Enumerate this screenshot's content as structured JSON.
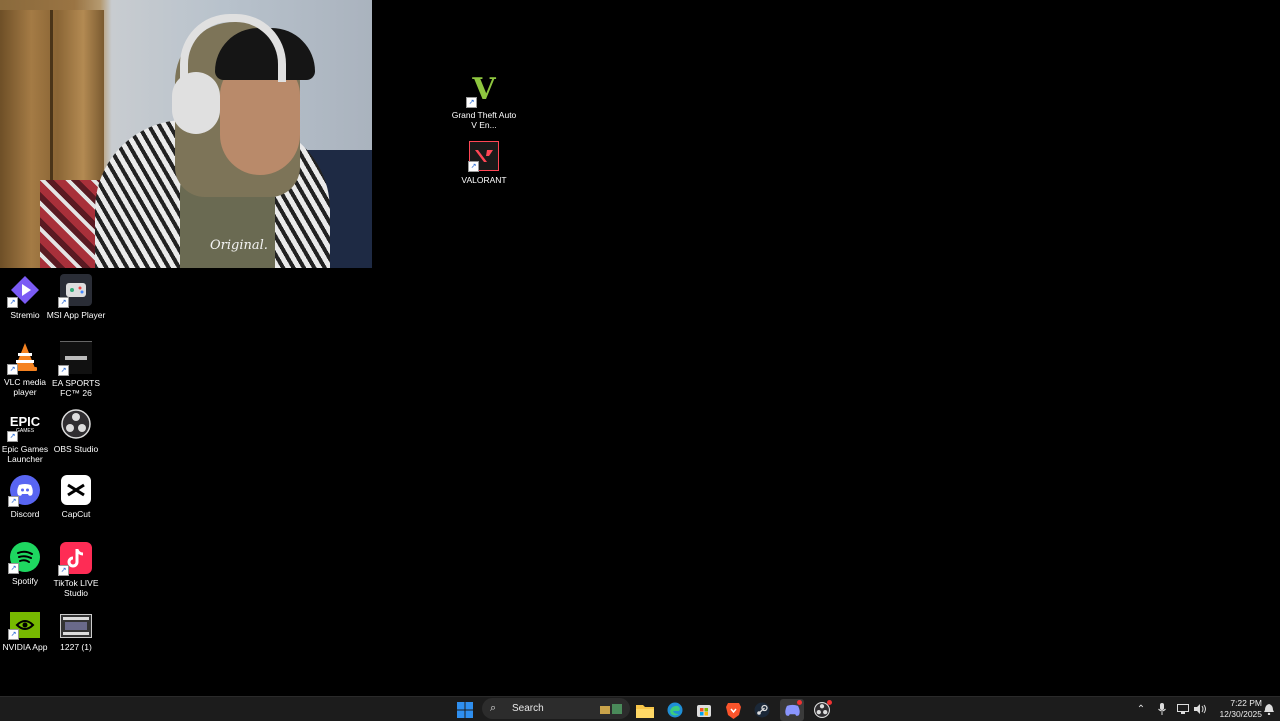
{
  "desktop": {
    "icons": [
      {
        "label": "Grand Theft Auto V En...",
        "icon": "gta-v-icon"
      },
      {
        "label": "VALORANT",
        "icon": "valorant-icon"
      },
      {
        "label": "Stremio",
        "icon": "stremio-icon"
      },
      {
        "label": "MSI App Player",
        "icon": "msi-app-player-icon"
      },
      {
        "label": "VLC media player",
        "icon": "vlc-icon"
      },
      {
        "label": "EA SPORTS FC™ 26",
        "icon": "ea-sports-fc-icon"
      },
      {
        "label": "Epic Games Launcher",
        "icon": "epic-games-icon"
      },
      {
        "label": "OBS Studio",
        "icon": "obs-studio-icon"
      },
      {
        "label": "Discord",
        "icon": "discord-icon"
      },
      {
        "label": "CapCut",
        "icon": "capcut-icon"
      },
      {
        "label": "Spotify",
        "icon": "spotify-icon"
      },
      {
        "label": "TikTok LIVE Studio",
        "icon": "tiktok-live-icon"
      },
      {
        "label": "NVIDIA App",
        "icon": "nvidia-icon"
      },
      {
        "label": "1227 (1)",
        "icon": "video-file-icon"
      }
    ],
    "icon_texts": {
      "epic": "EPIC",
      "epic_sub": "GAMES",
      "gta_logo": "V"
    }
  },
  "webcam": {
    "shirt_text": "Original."
  },
  "taskbar": {
    "search_placeholder": "Search",
    "pinned": [
      "start-icon",
      "file-explorer-icon",
      "edge-icon",
      "store-icon",
      "brave-icon",
      "steam-icon",
      "discord-icon",
      "obs-icon"
    ],
    "clock_time": "7:22 PM",
    "clock_date": "12/30/2025"
  },
  "colors": {
    "desktop_bg": "#000000",
    "taskbar_bg": "#1c1c1c",
    "windows_blue": "#2f8fef",
    "discord": "#5865f2",
    "spotify": "#1ed760",
    "valorant": "#ff4655",
    "nvidia": "#76b900"
  }
}
